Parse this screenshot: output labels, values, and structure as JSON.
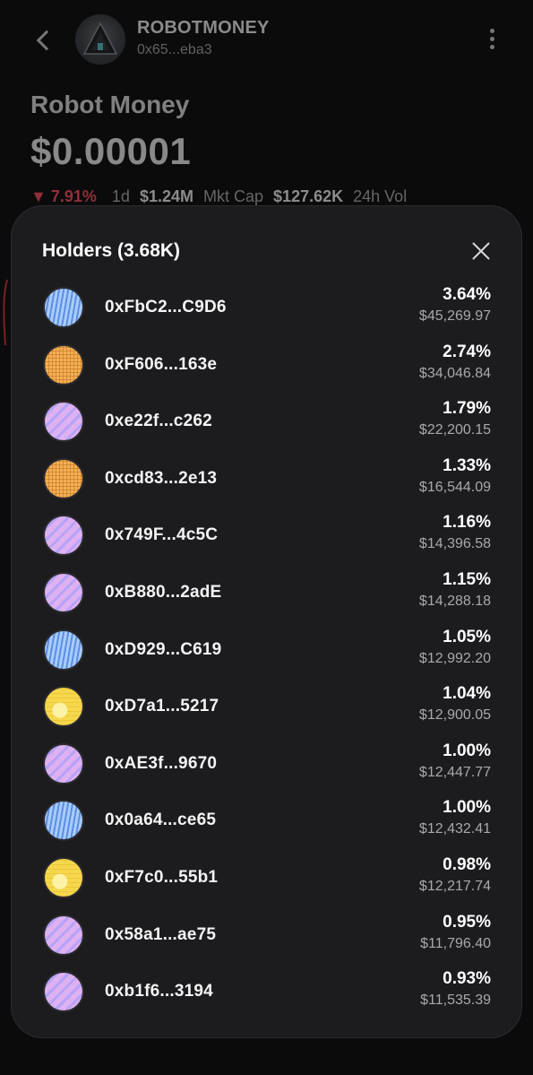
{
  "header": {
    "symbol": "ROBOTMONEY",
    "address": "0x65...eba3",
    "logo_icon": "pyramid-logo-icon"
  },
  "token": {
    "name": "Robot Money",
    "price": "$0.00001",
    "change": "7.91%",
    "change_direction": "down",
    "period": "1d",
    "market_cap_value": "$1.24M",
    "market_cap_label": "Mkt Cap",
    "volume_value": "$127.62K",
    "volume_label": "24h Vol"
  },
  "holders_sheet": {
    "title": "Holders (3.68K)",
    "close_icon": "close-icon",
    "holders": [
      {
        "address": "0xFbC2...C9D6",
        "percent": "3.64%",
        "value": "$45,269.97",
        "avatar": "blue"
      },
      {
        "address": "0xF606...163e",
        "percent": "2.74%",
        "value": "$34,046.84",
        "avatar": "orange"
      },
      {
        "address": "0xe22f...c262",
        "percent": "1.79%",
        "value": "$22,200.15",
        "avatar": "pink"
      },
      {
        "address": "0xcd83...2e13",
        "percent": "1.33%",
        "value": "$16,544.09",
        "avatar": "orange"
      },
      {
        "address": "0x749F...4c5C",
        "percent": "1.16%",
        "value": "$14,396.58",
        "avatar": "pink"
      },
      {
        "address": "0xB880...2adE",
        "percent": "1.15%",
        "value": "$14,288.18",
        "avatar": "pink"
      },
      {
        "address": "0xD929...C619",
        "percent": "1.05%",
        "value": "$12,992.20",
        "avatar": "blue"
      },
      {
        "address": "0xD7a1...5217",
        "percent": "1.04%",
        "value": "$12,900.05",
        "avatar": "yellow"
      },
      {
        "address": "0xAE3f...9670",
        "percent": "1.00%",
        "value": "$12,447.77",
        "avatar": "pink"
      },
      {
        "address": "0x0a64...ce65",
        "percent": "1.00%",
        "value": "$12,432.41",
        "avatar": "blue"
      },
      {
        "address": "0xF7c0...55b1",
        "percent": "0.98%",
        "value": "$12,217.74",
        "avatar": "yellow"
      },
      {
        "address": "0x58a1...ae75",
        "percent": "0.95%",
        "value": "$11,796.40",
        "avatar": "pink"
      },
      {
        "address": "0xb1f6...3194",
        "percent": "0.93%",
        "value": "$11,535.39",
        "avatar": "pink"
      }
    ]
  },
  "colors": {
    "background": "#0b0b0c",
    "sheet": "#1c1c1f",
    "negative": "#ff4d5e",
    "muted_text": "#a9a9ad"
  }
}
